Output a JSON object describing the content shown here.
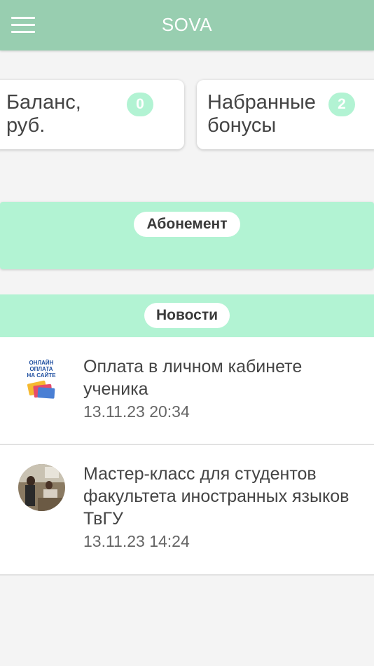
{
  "app_bar": {
    "title": "SOVA"
  },
  "cards": {
    "balance": {
      "label": "Баланс, руб.",
      "value": "0"
    },
    "bonuses": {
      "label": "Набранные бонусы",
      "value": "2"
    }
  },
  "subscription": {
    "title": "Абонемент"
  },
  "news": {
    "title": "Новости",
    "items": [
      {
        "title": "Оплата в личном кабинете ученика",
        "date": "13.11.23 20:34",
        "thumb_text": [
          "ОНЛАЙН",
          "ОПЛАТА",
          "НА САЙТЕ"
        ]
      },
      {
        "title": "Мастер-класс для студентов факультета иностранных языков ТвГУ",
        "date": "13.11.23 14:24"
      }
    ]
  },
  "colors": {
    "app_bar": "#98ceb0",
    "accent": "#b2f3d3",
    "background": "#f4f4f4"
  }
}
